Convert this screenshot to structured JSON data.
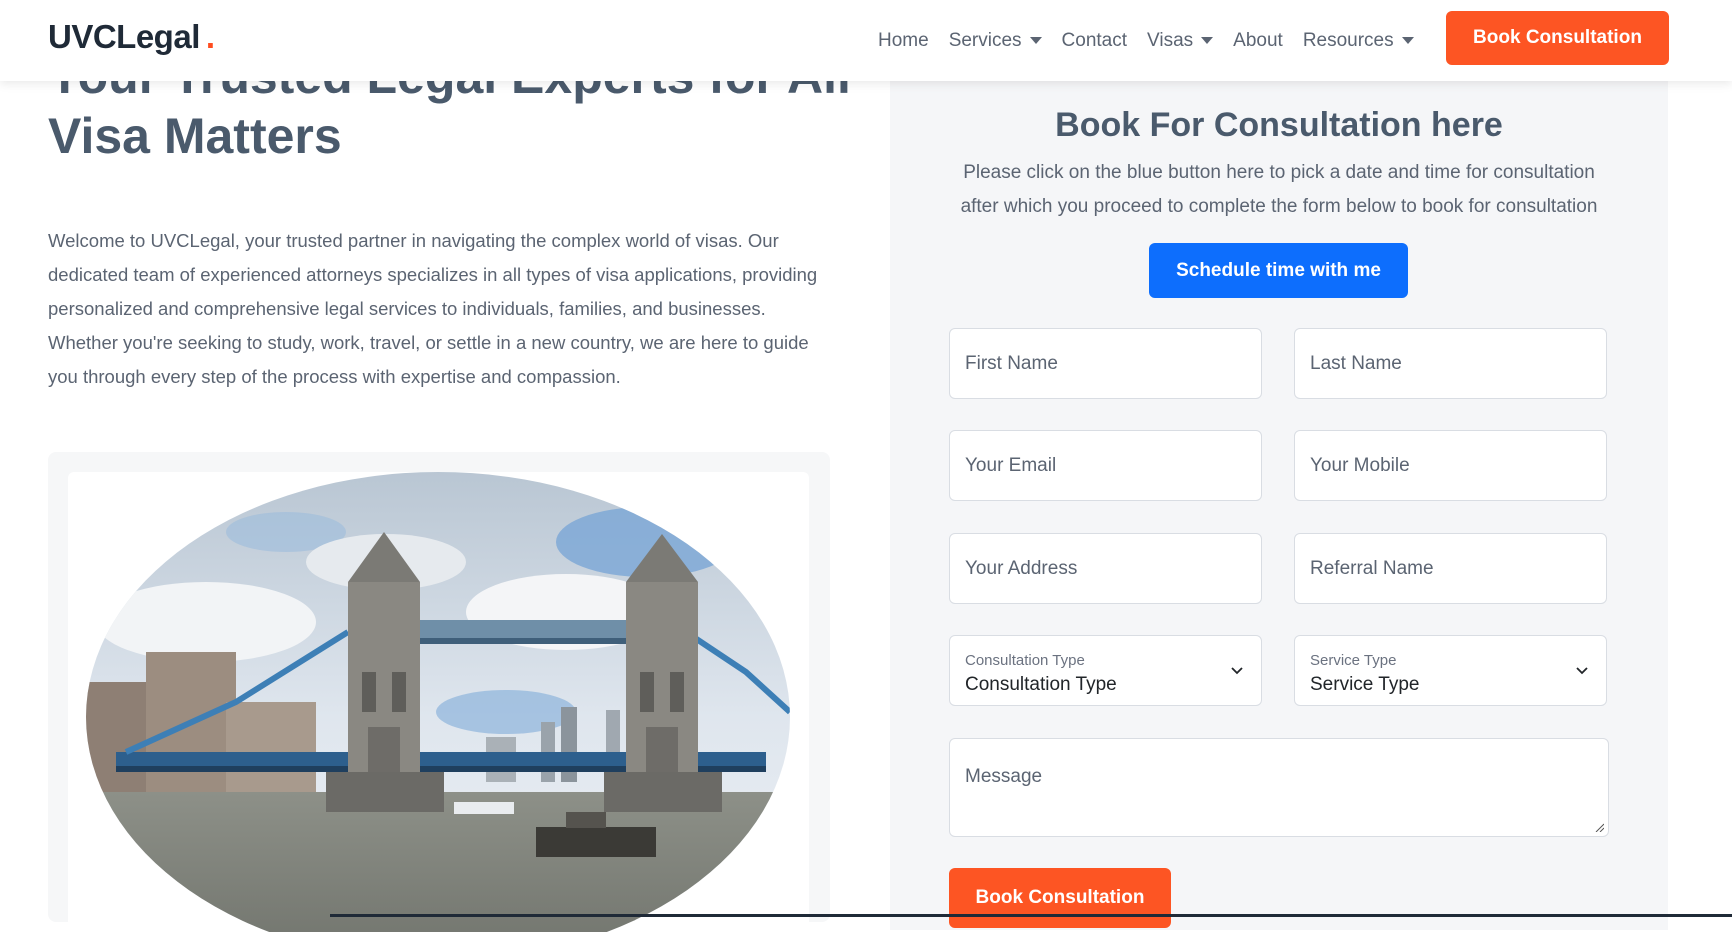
{
  "header": {
    "brand": "UVCLegal",
    "brand_dot": ".",
    "nav": {
      "home": "Home",
      "services": "Services",
      "contact": "Contact",
      "visas": "Visas",
      "about": "About",
      "resources": "Resources"
    },
    "cta_label": "Book Consultation"
  },
  "hero": {
    "title_line1": "Your Trusted Legal Experts for All",
    "title_line2": "Visa Matters",
    "intro": "Welcome to UVCLegal, your trusted partner in navigating the complex world of visas. Our dedicated team of experienced attorneys specializes in all types of visa applications, providing personalized and comprehensive legal services to individuals, families, and businesses. Whether you're seeking to study, work, travel, or settle in a new country, we are here to guide you through every step of the process with expertise and compassion."
  },
  "booking": {
    "title": "Book For Consultation here",
    "description": "Please click on the blue button here to pick a date and time for consultation after which you proceed to complete the form below to book for consultation",
    "schedule_label": "Schedule time with me",
    "fields": {
      "first_name": "First Name",
      "last_name": "Last Name",
      "email": "Your Email",
      "mobile": "Your Mobile",
      "address": "Your Address",
      "referral": "Referral Name"
    },
    "consultation_type": {
      "label": "Consultation Type",
      "value": "Consultation Type"
    },
    "service_type": {
      "label": "Service Type",
      "value": "Service Type"
    },
    "message_placeholder": "Message",
    "submit_label": "Book Consultation"
  },
  "colors": {
    "accent_orange": "#fd5523",
    "accent_blue": "#0d6efd",
    "heading": "#4a5a6c",
    "panel_bg": "#f5f6f8"
  }
}
